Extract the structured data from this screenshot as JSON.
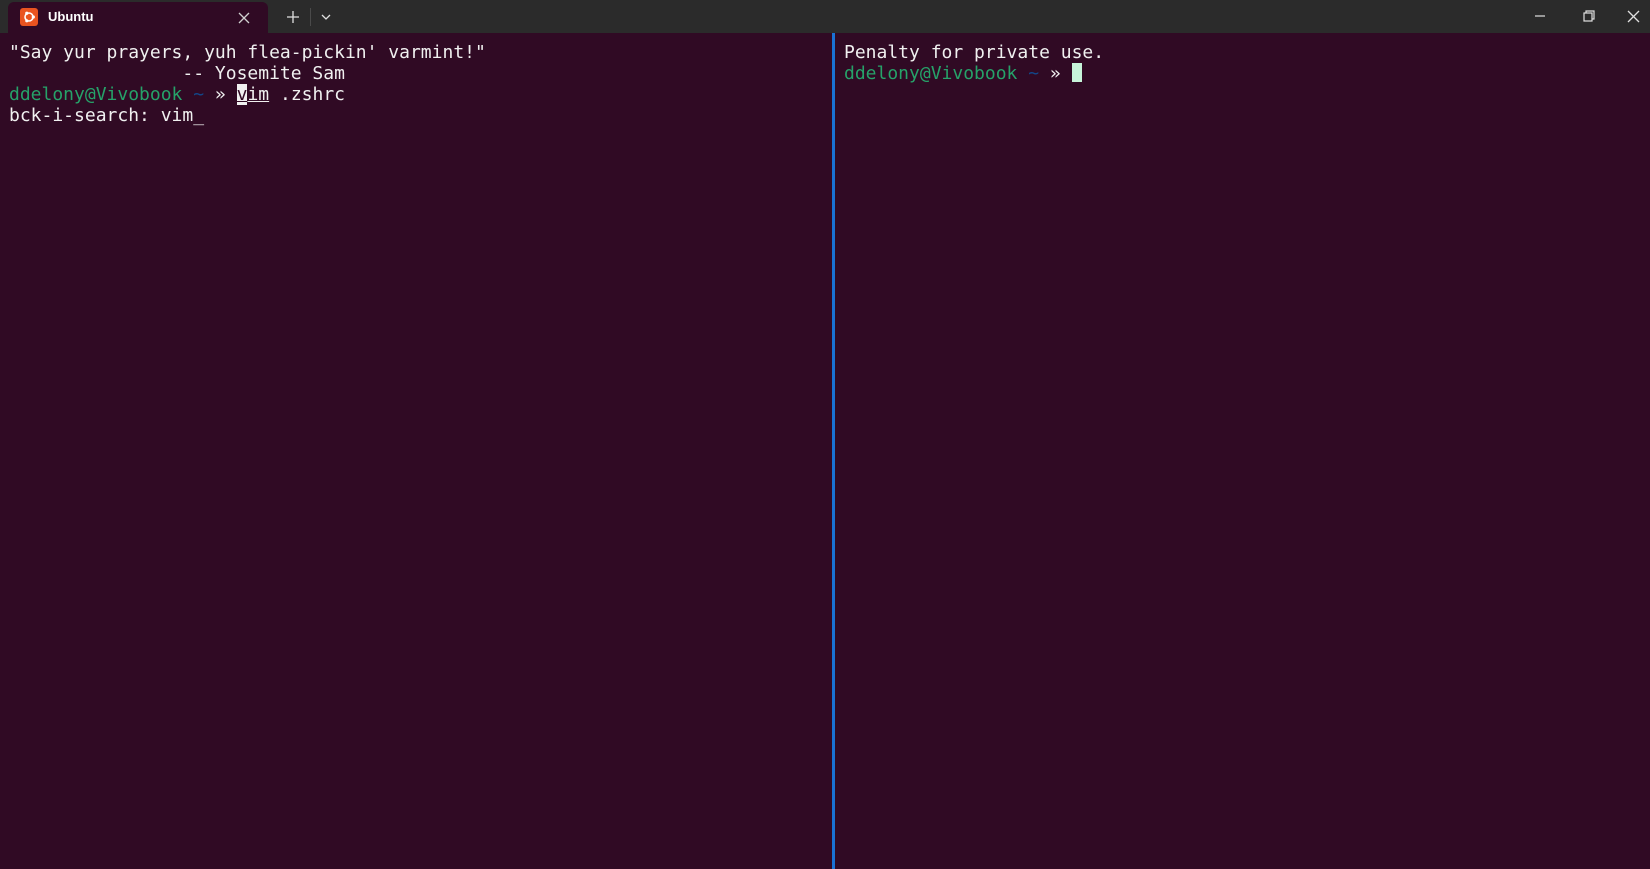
{
  "window": {
    "tab_title": "Ubuntu"
  },
  "left_pane": {
    "quote_line": "\"Say yur prayers, yuh flea-pickin' varmint!\"",
    "attribution_line": "                -- Yosemite Sam",
    "prompt": {
      "user_host": "ddelony@Vivobook",
      "dir": "~",
      "arrow": "»",
      "cmd_first_char": "v",
      "cmd_rest_underlined": "im",
      "cmd_args": " .zshrc"
    },
    "search_line": "bck-i-search: vim_"
  },
  "right_pane": {
    "fortune_line": "Penalty for private use.",
    "prompt": {
      "user_host": "ddelony@Vivobook",
      "dir": "~",
      "arrow": "»"
    }
  },
  "colors": {
    "terminal_bg": "#300a24",
    "titlebar_bg": "#2b2b2b",
    "prompt_green": "#26a269",
    "prompt_blue": "#12488b",
    "focus_divider": "#1a72d4",
    "ubuntu_orange": "#e95420"
  }
}
